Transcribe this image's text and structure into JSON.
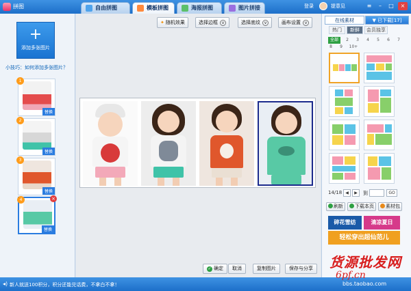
{
  "app": {
    "title": "拼图"
  },
  "tabs": [
    {
      "label": "自由拼图",
      "active": false,
      "icon": "free-collage-icon"
    },
    {
      "label": "模板拼图",
      "active": true,
      "icon": "template-collage-icon"
    },
    {
      "label": "海报拼图",
      "active": false,
      "icon": "poster-collage-icon"
    },
    {
      "label": "图片拼接",
      "active": false,
      "icon": "image-stitch-icon"
    }
  ],
  "topright": {
    "login": "登录",
    "feedback": "提意见"
  },
  "left": {
    "add_label": "添加多张图片",
    "add_icon": "+",
    "tip": "小技巧：如何添加多张图片？",
    "thumbs": [
      {
        "num": "1",
        "swap": "替换"
      },
      {
        "num": "2",
        "swap": "替换"
      },
      {
        "num": "3",
        "swap": "替换"
      },
      {
        "num": "4",
        "swap": "替换"
      }
    ],
    "remove_icon": "×"
  },
  "toolbar": {
    "random_label": "随机效果",
    "border_label": "选择边框",
    "texture_label": "选择底纹",
    "canvas_label": "画布设置"
  },
  "bottom": {
    "ok_label": "确定",
    "cancel_label": "取消",
    "copy_label": "复制图片",
    "save_label": "保存与分享"
  },
  "right": {
    "tab_online": "在线素材",
    "tab_downloaded": "已下载[17]",
    "subtabs": [
      "热门",
      "新鲜",
      "会员独享"
    ],
    "active_subtab": 1,
    "numbers": [
      "全部",
      "2",
      "3",
      "4",
      "5",
      "6",
      "7",
      "8",
      "9",
      "10+"
    ],
    "page": "14/18",
    "goto_label": "到",
    "go_label": "GO",
    "refresh_label": "刷新",
    "download_page_label": "下载本页",
    "library_label": "素材包",
    "ads": [
      "碎花雪纺",
      "清凉夏日",
      "轻松穿出超仙范儿"
    ]
  },
  "status": {
    "text": "新人就送100积分，积分还能兑话费，不拿白不拿！"
  },
  "watermark": {
    "line1": "货源批发网",
    "line2": "6pf.cn",
    "line3": "bbs.taobao.com"
  },
  "colors": {
    "accent": "#1d6fc9",
    "selection": "#1b2a8c",
    "template_selected": "#f0a326"
  }
}
